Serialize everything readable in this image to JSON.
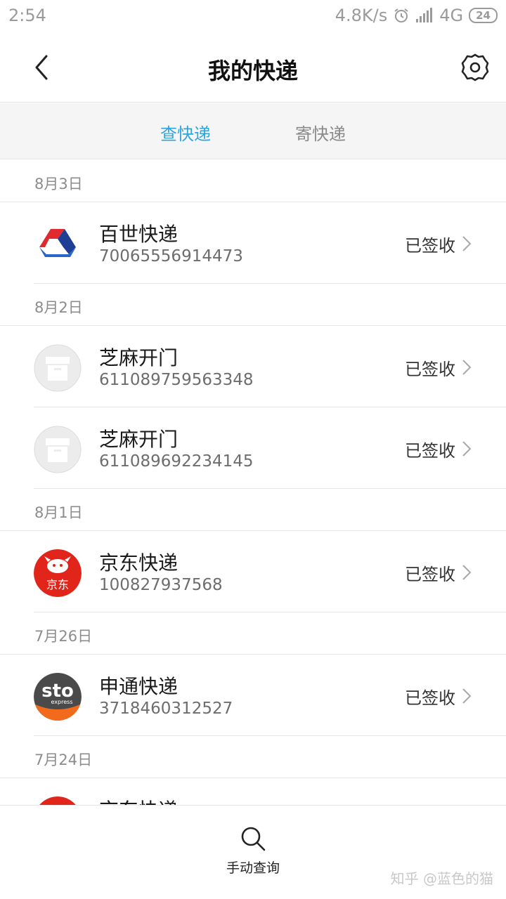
{
  "status_bar": {
    "time": "2:54",
    "speed": "4.8K/s",
    "network": "4G",
    "battery": "24"
  },
  "header": {
    "title": "我的快递"
  },
  "tabs": [
    {
      "label": "查快递"
    },
    {
      "label": "寄快递"
    }
  ],
  "groups": [
    {
      "date": "8月3日",
      "items": [
        {
          "name": "百世快递",
          "number": "70065556914473",
          "status": "已签收"
        }
      ]
    },
    {
      "date": "8月2日",
      "items": [
        {
          "name": "芝麻开门",
          "number": "611089759563348",
          "status": "已签收"
        },
        {
          "name": "芝麻开门",
          "number": "611089692234145",
          "status": "已签收"
        }
      ]
    },
    {
      "date": "8月1日",
      "items": [
        {
          "name": "京东快递",
          "number": "100827937568",
          "status": "已签收",
          "logo_text": "京东"
        }
      ]
    },
    {
      "date": "7月26日",
      "items": [
        {
          "name": "申通快递",
          "number": "3718460312527",
          "status": "已签收",
          "logo_text": "sto",
          "logo_subtext": "express"
        }
      ]
    },
    {
      "date": "7月24日",
      "items": [
        {
          "name": "京东快递",
          "number": "",
          "status": ""
        }
      ]
    }
  ],
  "bottom_bar": {
    "manual_label": "手动查询",
    "watermark": "知乎 @蓝色的猫"
  },
  "colors": {
    "accent": "#2fa5dd",
    "jd_red": "#e1251b",
    "sto_orange": "#f26b1d",
    "sto_gray": "#4a4a4a"
  }
}
